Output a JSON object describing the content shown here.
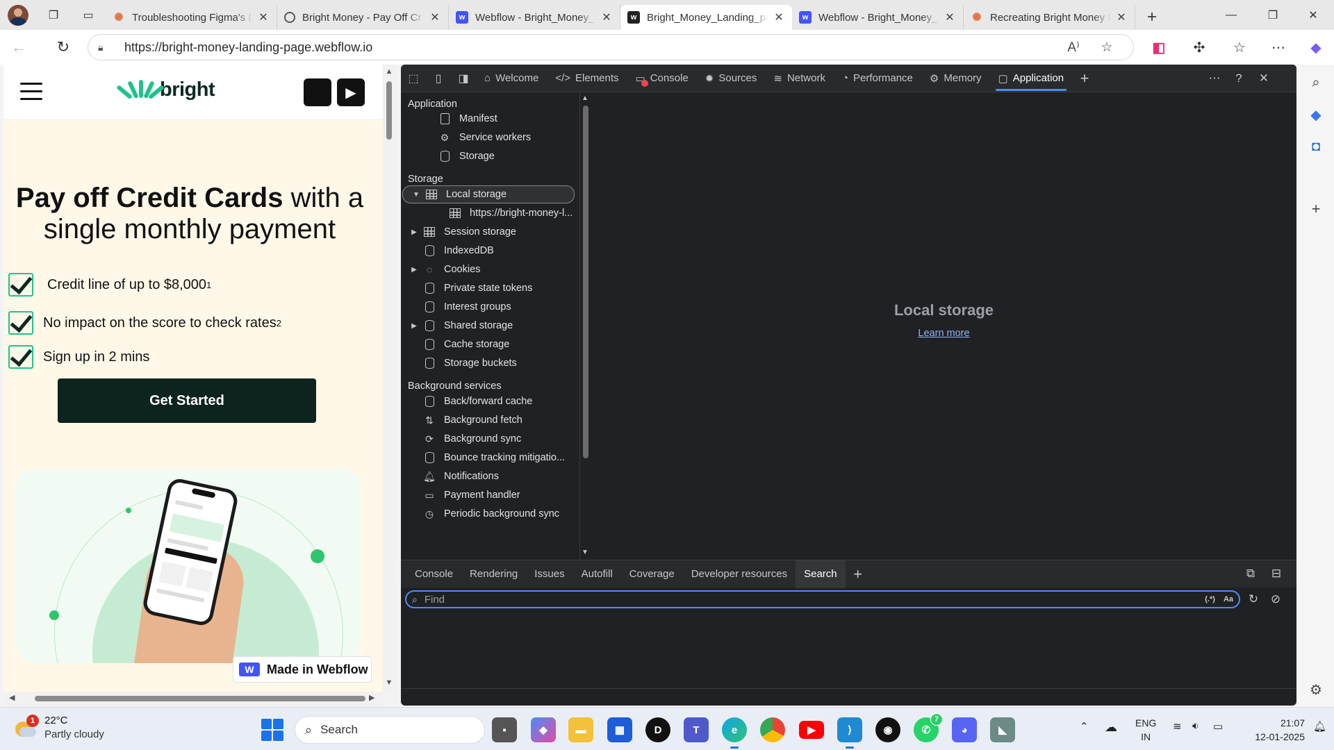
{
  "browser": {
    "tabs": [
      {
        "title": "Troubleshooting Figma's (",
        "favicon": "figma-icon"
      },
      {
        "title": "Bright Money - Pay Off Cr",
        "favicon": "globe-icon"
      },
      {
        "title": "Webflow - Bright_Money_",
        "favicon": "webflow-icon"
      },
      {
        "title": "Bright_Money_Landing_pa",
        "favicon": "webflow-icon",
        "active": true
      },
      {
        "title": "Webflow - Bright_Money_",
        "favicon": "webflow-icon"
      },
      {
        "title": "Recreating Bright Money I",
        "favicon": "figma-icon"
      }
    ],
    "url": "https://bright-money-landing-page.webflow.io"
  },
  "site": {
    "logo_text": "bright",
    "hero_bold": "Pay off Credit Cards",
    "hero_rest": " with a single monthly payment",
    "features": [
      {
        "text": "Credit line of up to $8,000",
        "sup": "1"
      },
      {
        "text": "No impact on the score to check rates",
        "sup": "2"
      },
      {
        "text": "Sign up in 2 mins",
        "sup": ""
      }
    ],
    "cta_label": "Get Started",
    "badge_label": "Made in Webflow",
    "accent": "#1ec38b",
    "dark": "#0d231d"
  },
  "devtools": {
    "tabs": [
      {
        "label": "Welcome",
        "icon": "home-icon"
      },
      {
        "label": "Elements",
        "icon": "code-icon"
      },
      {
        "label": "Console",
        "icon": "console-icon"
      },
      {
        "label": "Sources",
        "icon": "bug-icon"
      },
      {
        "label": "Network",
        "icon": "wifi-icon"
      },
      {
        "label": "Performance",
        "icon": "gauge-icon"
      },
      {
        "label": "Memory",
        "icon": "chip-icon"
      },
      {
        "label": "Application",
        "icon": "app-icon",
        "active": true
      }
    ],
    "sidebar": {
      "application_header": "Application",
      "application_items": [
        "Manifest",
        "Service workers",
        "Storage"
      ],
      "storage_header": "Storage",
      "local_storage": "Local storage",
      "local_storage_child": "https://bright-money-l...",
      "storage_items": [
        "Session storage",
        "IndexedDB",
        "Cookies",
        "Private state tokens",
        "Interest groups",
        "Shared storage",
        "Cache storage",
        "Storage buckets"
      ],
      "background_header": "Background services",
      "background_items": [
        "Back/forward cache",
        "Background fetch",
        "Background sync",
        "Bounce tracking mitigatio...",
        "Notifications",
        "Payment handler",
        "Periodic background sync"
      ]
    },
    "main": {
      "title": "Local storage",
      "link": "Learn more"
    },
    "drawer": {
      "tabs": [
        "Console",
        "Rendering",
        "Issues",
        "Autofill",
        "Coverage",
        "Developer resources",
        "Search"
      ],
      "active": "Search",
      "find_placeholder": "Find",
      "regex_label": "(.*)",
      "case_label": "Aa"
    }
  },
  "taskbar": {
    "weather_temp": "22°C",
    "weather_desc": "Partly cloudy",
    "weather_badge": "1",
    "search_label": "Search",
    "whatsapp_badge": "7",
    "lang_line1": "ENG",
    "lang_line2": "IN",
    "time": "21:07",
    "date": "12-01-2025"
  }
}
